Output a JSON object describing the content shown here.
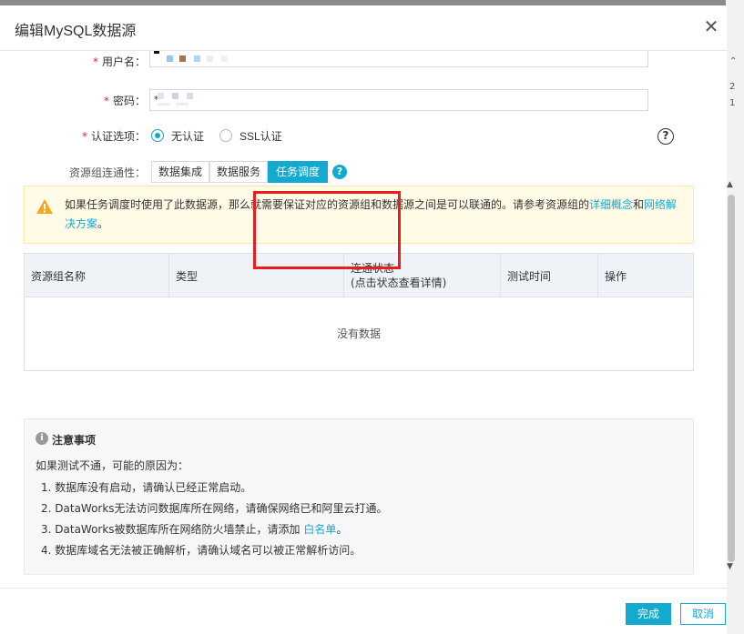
{
  "dialog": {
    "title": "编辑MySQL数据源",
    "close_glyph": "✕"
  },
  "form": {
    "username_label": "用户名：",
    "password_label": "密码：",
    "password_value": "*",
    "auth_label": "认证选项：",
    "auth_options": [
      "无认证",
      "SSL认证"
    ],
    "auth_selected": "无认证",
    "connectivity_label": "资源组连通性：",
    "connectivity_tabs": [
      "数据集成",
      "数据服务",
      "任务调度"
    ],
    "connectivity_active": "任务调度",
    "required_mark": "*"
  },
  "alert": {
    "text_before": "如果任务调度时使用了此数据源，那么就需要保证对应的资源组和数据源之间是可以联通的。请参考资源组的",
    "link1": "详细概念",
    "and": "和",
    "link2": "网络解决方案",
    "end": "。"
  },
  "table": {
    "columns": [
      "资源组名称",
      "类型",
      "连通状态",
      "测试时间",
      "操作"
    ],
    "status_sub": "(点击状态查看详情)",
    "empty_text": "没有数据"
  },
  "notice": {
    "title": "注意事项",
    "intro": "如果测试不通，可能的原因为：",
    "items": [
      "1.  数据库没有启动，请确认已经正常启动。",
      "2.  DataWorks无法访问数据库所在网络，请确保网络已和阿里云打通。",
      "3.  DataWorks被数据库所在网络防火墙禁止，请添加 ",
      "4.  数据库域名无法被正确解析，请确认域名可以被正常解析访问。"
    ],
    "item3_link": "白名单",
    "item3_end": "。"
  },
  "footer": {
    "ok": "完成",
    "cancel": "取消"
  },
  "bg_peek": [
    "2",
    "1"
  ],
  "colors": {
    "accent": "#14a9cf",
    "highlight": "#ea1c1c",
    "warning": "#f5a623"
  },
  "icons": {
    "close": "close-icon",
    "warning": "warning-icon",
    "help": "help-icon",
    "info": "info-icon"
  }
}
